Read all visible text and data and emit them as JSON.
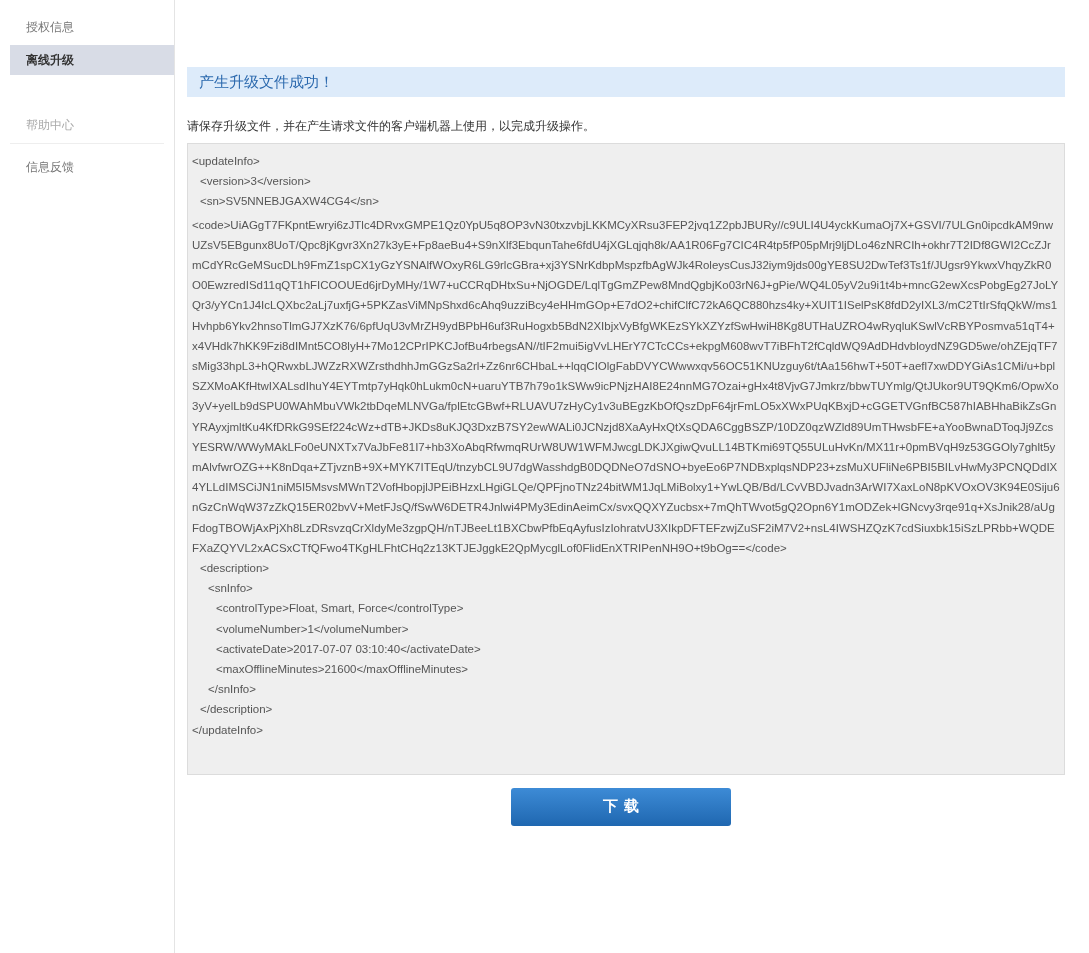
{
  "sidebar": {
    "items": [
      {
        "label": "授权信息",
        "kind": "item",
        "selected": false
      },
      {
        "label": "离线升级",
        "kind": "item",
        "selected": true
      },
      {
        "label": "帮助中心",
        "kind": "header",
        "selected": false
      },
      {
        "label": "信息反馈",
        "kind": "item",
        "selected": false
      }
    ]
  },
  "banner": {
    "text": "产生升级文件成功！"
  },
  "instruction": "请保存升级文件，并在产生请求文件的客户端机器上使用，以完成升级操作。",
  "file_content": {
    "open": "<updateInfo>",
    "close": "</updateInfo>",
    "children": [
      {
        "text": "<version>3</version>"
      },
      {
        "text": "<sn>SV5NNEBJGAXW4CG4</sn>"
      },
      {
        "kind": "code",
        "text": "<code>UiAGgT7FKpntEwryi6zJTlc4DRvxGMPE1Qz0YpU5q8OP3vN30txzvbjLKKMCyXRsu3FEP2jvq1Z2pbJBURy//c9ULI4U4yckKumaOj7X+GSVI/7ULGn0ipcdkAM9nwUZsV5EBgunx8UoT/Qpc8jKgvr3Xn27k3yE+Fp8aeBu4+S9nXlf3EbqunTahe6fdU4jXGLqjqh8k/AA1R06Fg7CIC4R4tp5fP05pMrj9ljDLo46zNRCIh+okhr7T2IDf8GWI2CcZJrmCdYRcGeMSucDLh9FmZ1spCX1yGzYSNAlfWOxyR6LG9rlcGBra+xj3YSNrKdbpMspzfbAgWJk4RoleysCusJ32iym9jds00gYE8SU2DwTef3Ts1f/JUgsr9YkwxVhqyZkR0O0EwzredISd11qQT1hFICOOUEd6jrDyMHy/1W7+uCCRqDHtxSu+NjOGDE/LqlTgGmZPew8MndQgbjKo03rN6J+gPie/WQ4L05yV2u9i1t4b+mncG2ewXcsPobgEg27JoLYQr3/yYCn1J4IcLQXbc2aLj7uxfjG+5PKZasViMNpShxd6cAhq9uzziBcy4eHHmGOp+E7dO2+chifClfC72kA6QC880hzs4ky+XUIT1ISelPsK8fdD2yIXL3/mC2TtIrSfqQkW/ms1Hvhpb6Ykv2hnsoTlmGJ7XzK76/6pfUqU3vMrZH9ydBPbH6uf3RuHogxb5BdN2XIbjxVyBfgWKEzSYkXZYzfSwHwiH8Kg8UTHaUZRO4wRyqluKSwlVcRBYPosmva51qT4+x4VHdk7hKK9Fzi8dIMnt5CO8lyH+7Mo12CPrIPKCJofBu4rbegsAN//tIF2mui5igVvLHErY7CTcCCs+ekpgM608wvT7iBFhT2fCqldWQ9AdDHdvbloydNZ9GD5we/ohZEjqTF7sMig33hpL3+hQRwxbLJWZzRXWZrsthdhhJmGGzSa2rl+Zz6nr6CHbaL++lqqCIOlgFabDVYCWwwxqv56OC51KNUzguy6t/tAa156hwT+50T+aefl7xwDDYGiAs1CMi/u+bplSZXMoAKfHtwIXALsdIhuY4EYTmtp7yHqk0hLukm0cN+uaruYTB7h79o1kSWw9icPNjzHAI8E24nnMG7Ozai+gHx4t8VjvG7Jmkrz/bbwTUYmlg/QtJUkor9UT9QKm6/OpwXo3yV+yelLb9dSPU0WAhMbuVWk2tbDqeMLNVGa/fplEtcGBwf+RLUAVU7zHyCy1v3uBEgzKbOfQszDpF64jrFmLO5xXWxPUqKBxjD+cGGETVGnfBC587hIABHhaBikZsGnYRAyxjmltKu4KfDRkG9SEf224cWz+dTB+JKDs8uKJQ3DxzB7SY2ewWALi0JCNzjd8XaAyHxQtXsQDA6CggBSZP/10DZ0qzWZld89UmTHwsbFE+aYooBwnaDToqJj9ZcsYESRW/WWyMAkLFo0eUNXTx7VaJbFe81I7+hb3XoAbqRfwmqRUrW8UW1WFMJwcgLDKJXgiwQvuLL14BTKmi69TQ55ULuHvKn/MX11r+0pmBVqH9z53GGOly7ghlt5ymAlvfwrOZG++K8nDqa+ZTjvznB+9X+MYK7ITEqU/tnzybCL9U7dgWasshdgB0DQDNeO7dSNO+byeEo6P7NDBxplqsNDP23+zsMuXUFliNe6PBI5BILvHwMy3PCNQDdIX4YLLdIMSCiJN1niM5I5MsvsMWnT2VofHbopjlJPEiBHzxLHgiGLQe/QPFjnoTNz24bitWM1JqLMiBolxy1+YwLQB/Bd/LCvVBDJvadn3ArWI7XaxLoN8pKVOxOV3K94E0Siju6nGzCnWqW37zZkQ15ER02bvV+MetFJsQ/fSwW6DETR4Jnlwi4PMy3EdinAeimCx/svxQQXYZucbsx+7mQhTWvot5gQ2Opn6Y1mODZek+lGNcvy3rqe91q+XsJnik28/aUgFdogTBOWjAxPjXh8LzDRsvzqCrXldyMe3zgpQH/nTJBeeLt1BXCbwPfbEqAyfusIzIohratvU3XIkpDFTEFzwjZuSF2iM7V2+nsL4IWSHZQzK7cdSiuxbk15iSzLPRbb+WQDEFXaZQYVL2xACSxCTfQFwo4TKgHLFhtCHq2z13KTJEJggkE2QpMycglLof0FlidEnXTRIPenNH9O+t9bOg==</code>"
      },
      {
        "open": "<description>",
        "close": "</description>",
        "children": [
          {
            "open": "<snInfo>",
            "close": "</snInfo>",
            "children": [
              {
                "text": "<controlType>Float, Smart, Force</controlType>"
              },
              {
                "text": "<volumeNumber>1</volumeNumber>"
              },
              {
                "text": "<activateDate>2017-07-07 03:10:40</activateDate>"
              },
              {
                "text": "<maxOfflineMinutes>21600</maxOfflineMinutes>"
              }
            ]
          }
        ]
      }
    ]
  },
  "download_button": {
    "label": "下 载"
  }
}
